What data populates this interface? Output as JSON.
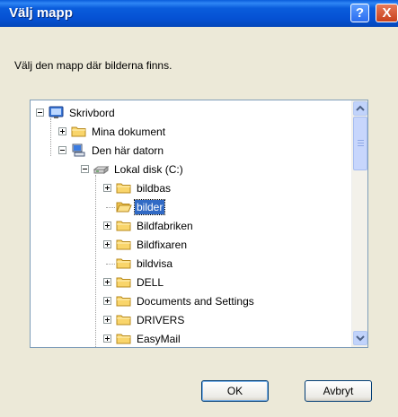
{
  "dialog": {
    "title": "Välj mapp",
    "instruction": "Välj den mapp där bilderna finns."
  },
  "titlebar_buttons": {
    "help_label": "?",
    "close_label": "X"
  },
  "tree": {
    "items": [
      {
        "label": "Skrivbord",
        "icon": "desktop-icon",
        "expander": "minus"
      },
      {
        "label": "Mina dokument",
        "icon": "folder-icon",
        "expander": "plus"
      },
      {
        "label": "Den här datorn",
        "icon": "computer-icon",
        "expander": "minus"
      },
      {
        "label": "Lokal disk (C:)",
        "icon": "drive-icon",
        "expander": "minus"
      },
      {
        "label": "bildbas",
        "icon": "folder-icon",
        "expander": "plus"
      },
      {
        "label": "bilder",
        "icon": "folder-open-icon",
        "expander": "none",
        "selected": true
      },
      {
        "label": "Bildfabriken",
        "icon": "folder-icon",
        "expander": "plus"
      },
      {
        "label": "Bildfixaren",
        "icon": "folder-icon",
        "expander": "plus"
      },
      {
        "label": "bildvisa",
        "icon": "folder-icon",
        "expander": "none"
      },
      {
        "label": "DELL",
        "icon": "folder-icon",
        "expander": "plus"
      },
      {
        "label": "Documents and Settings",
        "icon": "folder-icon",
        "expander": "plus"
      },
      {
        "label": "DRIVERS",
        "icon": "folder-icon",
        "expander": "plus"
      },
      {
        "label": "EasyMail",
        "icon": "folder-icon",
        "expander": "plus"
      }
    ]
  },
  "buttons": {
    "ok": "OK",
    "cancel": "Avbryt"
  },
  "colors": {
    "titlebar": "#0a5ddc",
    "selection": "#316ac5",
    "dialog_bg": "#ece9d8"
  }
}
